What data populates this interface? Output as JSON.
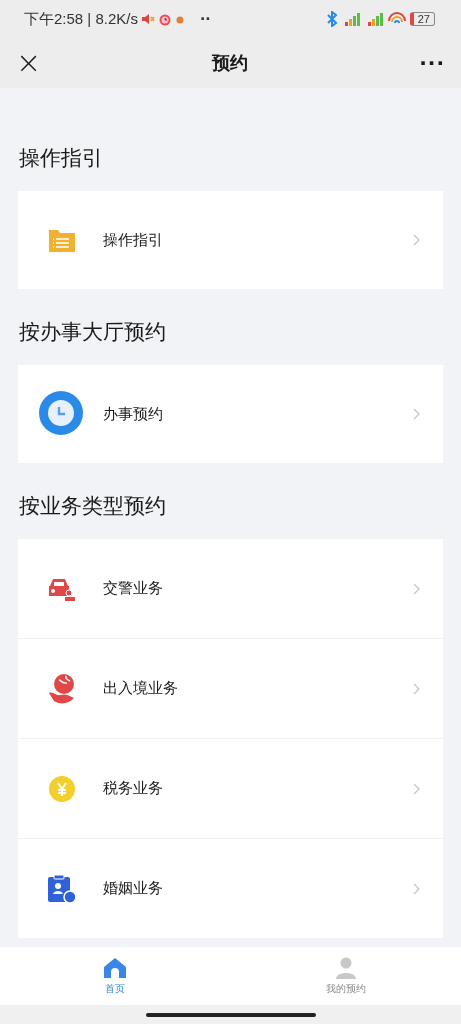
{
  "status_bar": {
    "time": "下午2:58 | 8.2K/s",
    "dots": "··",
    "battery": "27"
  },
  "nav": {
    "title": "预约",
    "close": "×",
    "more": "···"
  },
  "sections": [
    {
      "title": "操作指引",
      "items": [
        {
          "label": "操作指引",
          "kind": "folder"
        }
      ]
    },
    {
      "title": "按办事大厅预约",
      "items": [
        {
          "label": "办事预约",
          "kind": "clock"
        }
      ]
    },
    {
      "title": "按业务类型预约",
      "items": [
        {
          "label": "交警业务",
          "kind": "car"
        },
        {
          "label": "出入境业务",
          "kind": "globe"
        },
        {
          "label": "税务业务",
          "kind": "yen"
        },
        {
          "label": "婚姻业务",
          "kind": "clipboard"
        }
      ]
    }
  ],
  "tabs": [
    {
      "label": "首页",
      "kind": "home",
      "selected": true
    },
    {
      "label": "我的预约",
      "kind": "person",
      "selected": false
    }
  ]
}
